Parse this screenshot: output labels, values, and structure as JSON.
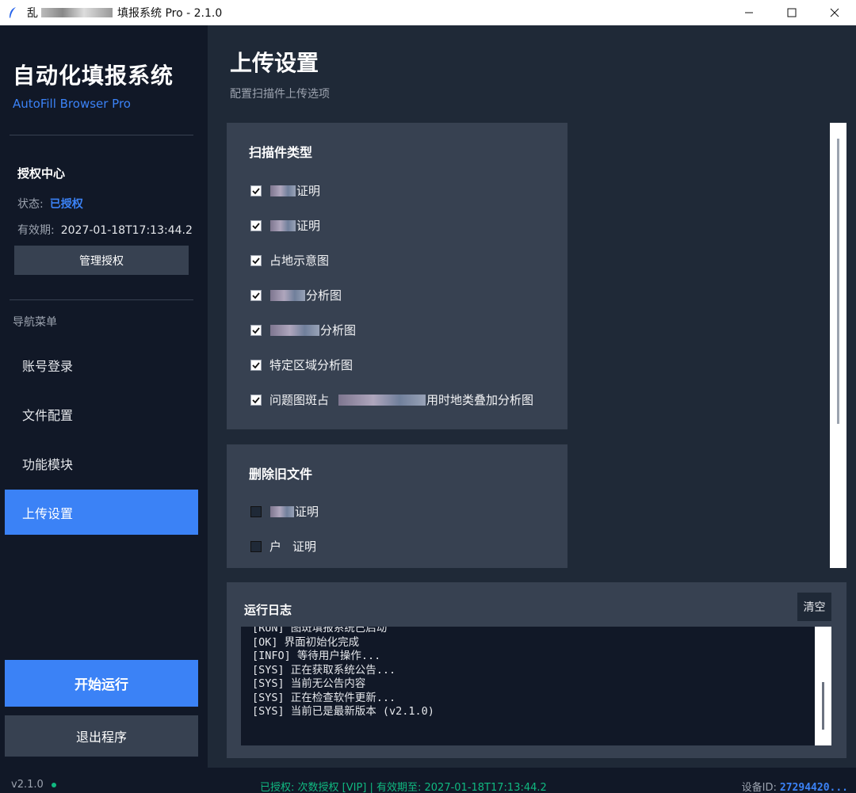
{
  "window": {
    "title_prefix": "乱",
    "title": "填报系统 Pro - 2.1.0"
  },
  "sidebar": {
    "brand_title": "自动化填报系统",
    "brand_subtitle": "AutoFill Browser Pro",
    "license": {
      "title": "授权中心",
      "status_label": "状态:",
      "status_value": "已授权",
      "expiry_label": "有效期:",
      "expiry_value": "2027-01-18T17:13:44.2",
      "manage_button": "管理授权"
    },
    "nav_label": "导航菜单",
    "nav_items": [
      {
        "label": "账号登录",
        "active": false
      },
      {
        "label": "文件配置",
        "active": false
      },
      {
        "label": "功能模块",
        "active": false
      },
      {
        "label": "上传设置",
        "active": true
      }
    ],
    "start_button": "开始运行",
    "exit_button": "退出程序"
  },
  "main": {
    "title": "上传设置",
    "subtitle": "配置扫描件上传选项",
    "scan_types": {
      "title": "扫描件类型",
      "items": [
        {
          "pre": "",
          "post": "证明",
          "checked": true
        },
        {
          "pre": "",
          "post": "证明",
          "checked": true
        },
        {
          "pre": "占地示意图",
          "post": "",
          "checked": true
        },
        {
          "pre": "",
          "post": "分析图",
          "checked": true
        },
        {
          "pre": "",
          "post": "分析图",
          "checked": true
        },
        {
          "pre": "特定区域分析图",
          "post": "",
          "checked": true
        },
        {
          "pre": "问题图斑占",
          "post": "用时地类叠加分析图",
          "checked": true
        }
      ]
    },
    "delete_old": {
      "title": "删除旧文件",
      "items": [
        {
          "pre": "",
          "post": "证明",
          "checked": false
        },
        {
          "pre": "户",
          "post": "证明",
          "checked": false
        }
      ]
    },
    "log": {
      "title": "运行日志",
      "clear_button": "清空",
      "lines": [
        "[RUN] 图斑填报系统已启动",
        "[OK] 界面初始化完成",
        "[INFO] 等待用户操作...",
        "[SYS] 正在获取系统公告...",
        "[SYS] 当前无公告内容",
        "[SYS] 正在检查软件更新...",
        "[SYS] 当前已是最新版本 (v2.1.0)"
      ]
    }
  },
  "statusbar": {
    "version": "v2.1.0",
    "center": "已授权: 次数授权 [VIP] | 有效期至: 2027-01-18T17:13:44.2",
    "device_label": "设备ID:",
    "device_value": "27294420..."
  },
  "colors": {
    "accent": "#3b82f6",
    "success": "#10b981",
    "sidebar_bg": "#111827",
    "main_bg": "#1f2937",
    "card_bg": "#374151"
  }
}
